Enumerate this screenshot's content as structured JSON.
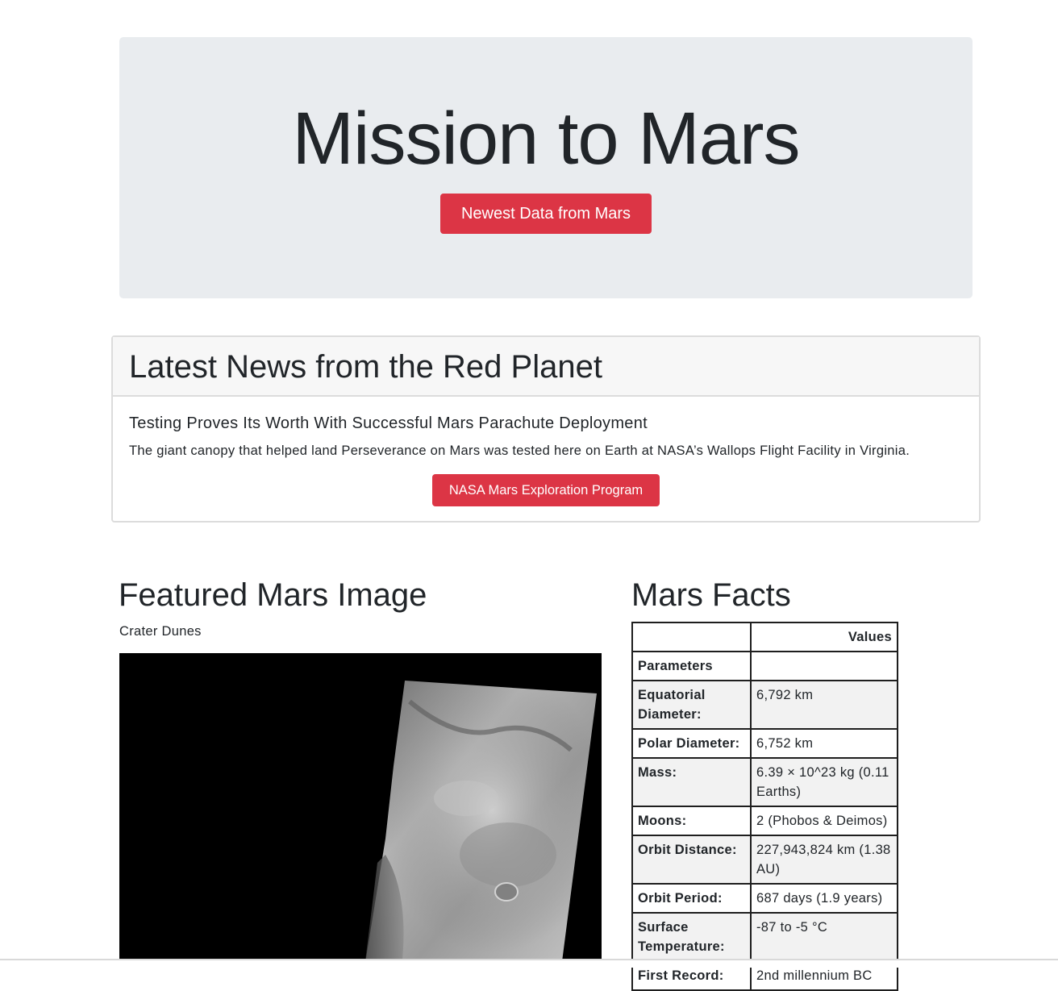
{
  "jumbotron": {
    "title": "Mission to Mars",
    "scrape_button": "Newest Data from Mars"
  },
  "news": {
    "header": "Latest News from the Red Planet",
    "title": "Testing Proves Its Worth With Successful Mars Parachute Deployment",
    "teaser": "The giant canopy that helped land Perseverance on Mars was tested here on Earth at NASA’s Wallops Flight Facility in Virginia.",
    "button": "NASA Mars Exploration Program"
  },
  "featured": {
    "heading": "Featured Mars Image",
    "caption": "Crater Dunes"
  },
  "facts": {
    "heading": "Mars Facts",
    "header_blank": "",
    "header_values": "Values",
    "rows": [
      {
        "label": "Parameters",
        "value": ""
      },
      {
        "label": "Equatorial Diameter:",
        "value": "6,792 km"
      },
      {
        "label": "Polar Diameter:",
        "value": "6,752 km"
      },
      {
        "label": "Mass:",
        "value": "6.39 × 10^23 kg (0.11 Earths)"
      },
      {
        "label": "Moons:",
        "value": "2 (Phobos & Deimos)"
      },
      {
        "label": "Orbit Distance:",
        "value": "227,943,824 km (1.38 AU)"
      },
      {
        "label": "Orbit Period:",
        "value": "687 days (1.9 years)"
      },
      {
        "label": "Surface Temperature:",
        "value": "-87 to -5 °C"
      },
      {
        "label": "First Record:",
        "value": "2nd millennium BC"
      }
    ]
  },
  "colors": {
    "accent": "#dc3545",
    "jumbotron_bg": "#e9ecef"
  }
}
